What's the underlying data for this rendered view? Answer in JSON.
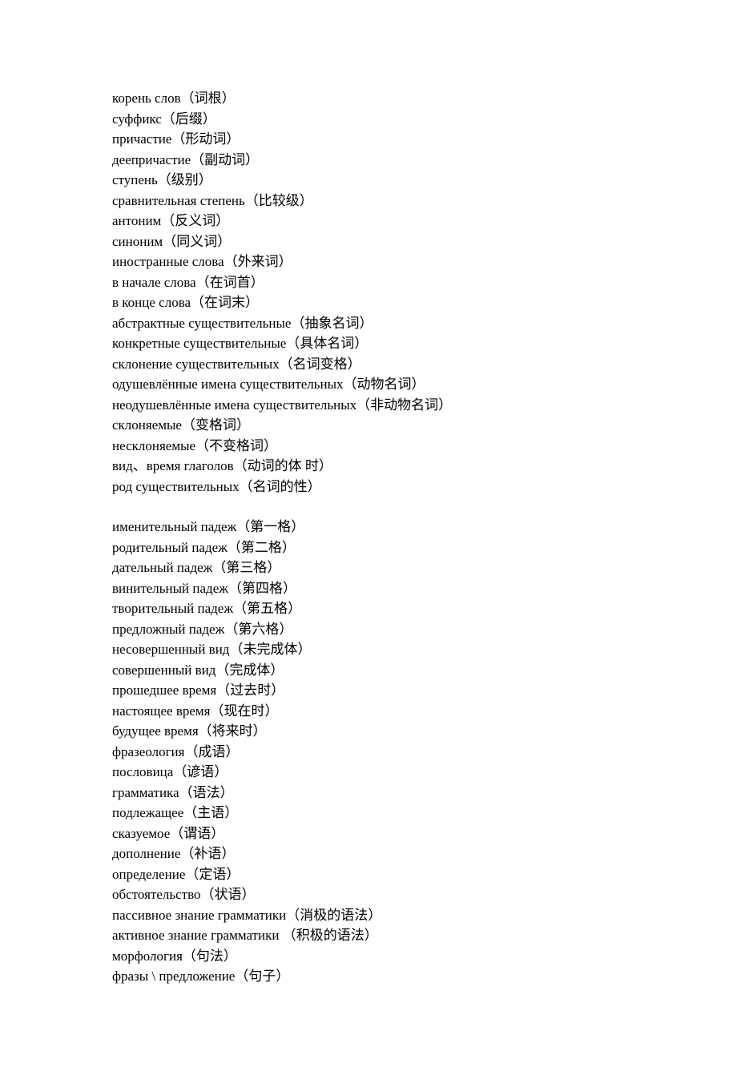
{
  "block1": [
    "корень слов（词根）",
    "суффикс（后缀）",
    "причастие（形动词）",
    "деепричастие（副动词）",
    "ступень（级别）",
    "сравнительная степень（比较级）",
    "антоним（反义词）",
    "синоним（同义词）",
    "иностранные слова（外来词）",
    "в начале слова（在词首）",
    "в конце слова（在词末）",
    "абстрактные существительные（抽象名词）",
    "конкретные существительные（具体名词）",
    "склонение существительных（名词变格）",
    "одушевлённые имена существительных（动物名词）",
    "неодушевлённые имена существительных（非动物名词）",
    "склоняемые（变格词）",
    "несклоняемые（不变格词）",
    "вид、время глаголов（动词的体  时）",
    "род существительных（名词的性）"
  ],
  "block2": [
    "именительный падеж（第一格）",
    "родительный падеж（第二格）",
    "дательный падеж（第三格）",
    "винительный падеж（第四格）",
    "творительный падеж（第五格）",
    "предложный падеж（第六格）",
    "несовершенный вид（未完成体）",
    "совершенный вид（完成体）",
    "прошедшее время（过去时）",
    "настоящее время（现在时）",
    "будущее время（将来时）",
    "фразеология（成语）",
    "пословица（谚语）",
    "грамматика（语法）",
    "подлежащее（主语）",
    "сказуемое（谓语）",
    "дополнение（补语）",
    "определение（定语）",
    "обстоятельство（状语）",
    "пассивное знание грамматики（消极的语法）",
    "активное знание грамматики  （积极的语法）",
    "морфология（句法）",
    "фразы \\ предложение（句子）"
  ]
}
